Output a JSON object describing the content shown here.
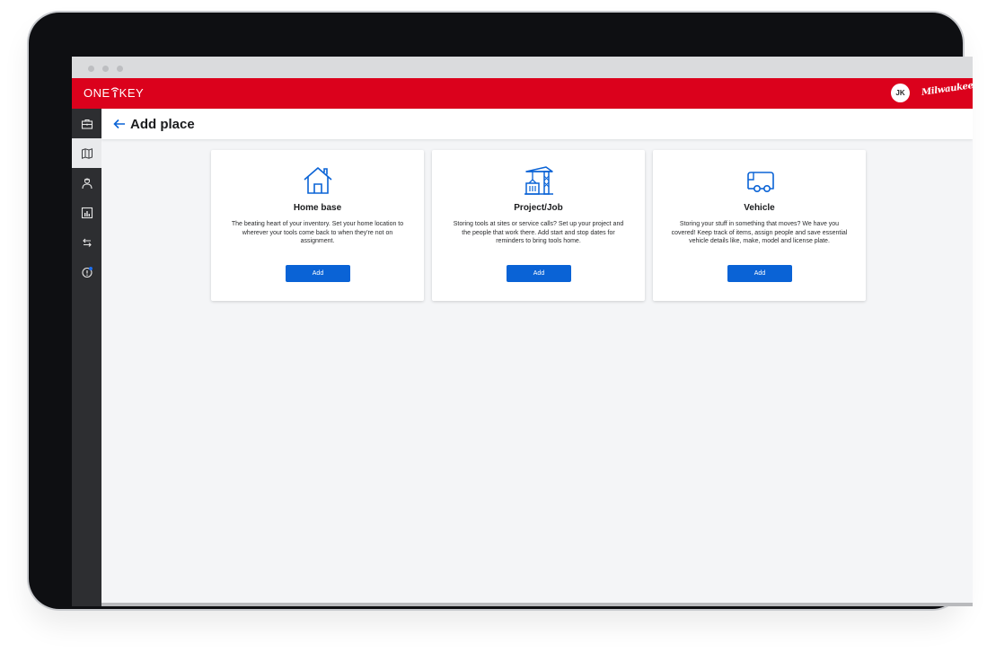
{
  "app": {
    "logo_left": "ONE",
    "logo_right": "KEY",
    "avatar_initials": "JK",
    "brand": "Milwaukee"
  },
  "sidebar": {
    "items": [
      {
        "icon": "toolbox-icon"
      },
      {
        "icon": "map-icon",
        "active": true
      },
      {
        "icon": "person-icon"
      },
      {
        "icon": "report-icon"
      },
      {
        "icon": "transfer-icon"
      },
      {
        "icon": "alert-icon"
      }
    ]
  },
  "header": {
    "title": "Add place"
  },
  "cards": [
    {
      "title": "Home base",
      "description": "The beating heart of your inventory. Set your home location to wherever your tools come back to when they're not on assignment.",
      "button": "Add",
      "icon": "house-icon"
    },
    {
      "title": "Project/Job",
      "description": "Storing tools at sites or service calls? Set up your project and the people that work there. Add start and stop dates for reminders to bring tools home.",
      "button": "Add",
      "icon": "crane-icon"
    },
    {
      "title": "Vehicle",
      "description": "Storing your stuff in something that moves? We have you covered! Keep track of items, assign people and save essential vehicle details like, make, model and license plate.",
      "button": "Add",
      "icon": "van-icon"
    }
  ],
  "colors": {
    "brand_red": "#db011c",
    "accent_blue": "#0a63d6",
    "sidebar_dark": "#2d2e31"
  }
}
